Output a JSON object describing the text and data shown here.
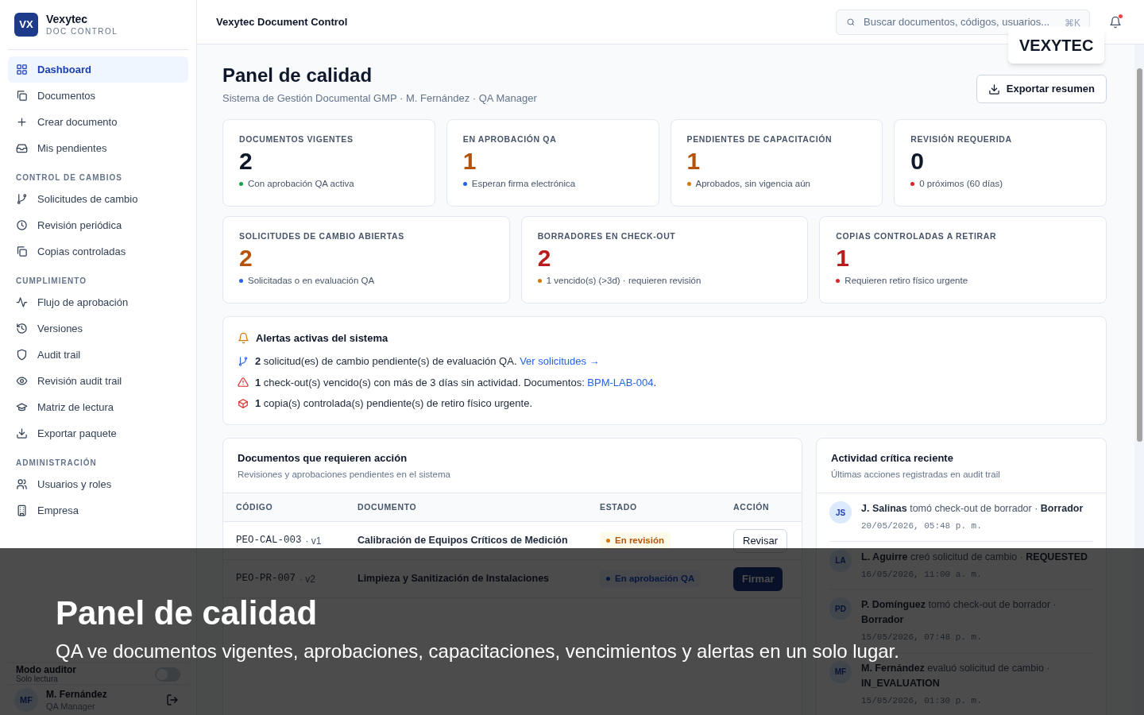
{
  "sidebar": {
    "logo": "VX",
    "brand": "Vexytec",
    "subtitle": "DOC CONTROL",
    "sections": [
      {
        "items": [
          {
            "label": "Dashboard",
            "selected": true
          },
          {
            "label": "Documentos",
            "selected": false
          },
          {
            "label": "Crear documento",
            "selected": false
          },
          {
            "label": "Mis pendientes",
            "selected": false
          }
        ]
      },
      {
        "title": "CONTROL DE CAMBIOS",
        "items": [
          {
            "label": "Solicitudes de cambio",
            "selected": false
          },
          {
            "label": "Revisión periódica",
            "selected": false
          },
          {
            "label": "Copias controladas",
            "selected": false
          }
        ]
      },
      {
        "title": "CUMPLIMIENTO",
        "items": [
          {
            "label": "Flujo de aprobación",
            "selected": false
          },
          {
            "label": "Versiones",
            "selected": false
          },
          {
            "label": "Audit trail",
            "selected": false
          },
          {
            "label": "Revisión audit trail",
            "selected": false
          },
          {
            "label": "Matriz de lectura",
            "selected": false
          },
          {
            "label": "Exportar paquete",
            "selected": false
          }
        ]
      },
      {
        "title": "ADMINISTRACIÓN",
        "items": [
          {
            "label": "Usuarios y roles",
            "selected": false
          },
          {
            "label": "Empresa",
            "selected": false
          }
        ]
      }
    ],
    "auditor_mode": {
      "label": "Modo auditor",
      "note": "Solo lectura",
      "on": false
    },
    "user": {
      "initials": "MF",
      "name": "M. Fernández",
      "role": "QA Manager"
    }
  },
  "header": {
    "title": "Vexytec Document Control",
    "search": {
      "placeholder": "Buscar documentos, códigos, usuarios...",
      "shortcut": "⌘K"
    },
    "unread": true,
    "brand_badge": "VEXYTEC"
  },
  "page": {
    "title": "Panel de calidad",
    "subtitle": "Sistema de Gestión Documental GMP · M. Fernández · QA Manager",
    "export_button": "Exportar resumen"
  },
  "stats": [
    {
      "label": "DOCUMENTOS VIGENTES",
      "value": "2",
      "kind": "neutral",
      "note": "Con aprobación QA activa",
      "color": "#16a34a"
    },
    {
      "label": "EN APROBACIÓN QA",
      "value": "1",
      "kind": "warning",
      "note": "Esperan firma electrónica",
      "color": "#2563eb"
    },
    {
      "label": "PENDIENTES DE CAPACITACIÓN",
      "value": "1",
      "kind": "warning",
      "note": "Aprobados, sin vigencia aún",
      "color": "#d97706"
    },
    {
      "label": "REVISIÓN REQUERIDA",
      "value": "0",
      "kind": "neutral",
      "note": "0 próximos (60 días)",
      "color": "#dc2626"
    }
  ],
  "stats_secondary": [
    {
      "label": "SOLICITUDES DE CAMBIO ABIERTAS",
      "value": "2",
      "kind": "warning",
      "note": "Solicitadas o en evaluación QA",
      "color": "#2563eb"
    },
    {
      "label": "BORRADORES EN CHECK-OUT",
      "value": "2",
      "kind": "danger",
      "note": "1 vencido(s) (>3d) · requieren revisión",
      "color": "#d97706"
    },
    {
      "label": "COPIAS CONTROLADAS A RETIRAR",
      "value": "1",
      "kind": "danger",
      "note": "Requieren retiro físico urgente",
      "color": "#dc2626"
    }
  ],
  "alerts": {
    "title": "Alertas activas del sistema",
    "items": [
      {
        "kind": "request",
        "text": "**2** solicitud(es) de cambio pendiente(s) de evaluación QA. ",
        "link": "Ver solicitudes →"
      },
      {
        "kind": "warning",
        "text": "**1** check-out(s) vencido(s) con más de 3 días sin actividad. Documentos: ",
        "link": "BPM-LAB-004",
        "after": "."
      },
      {
        "kind": "package",
        "text": "**1** copia(s) controlada(s) pendiente(s) de retiro físico urgente."
      }
    ]
  },
  "documents": {
    "title": "Documentos que requieren acción",
    "subtitle": "Revisiones y aprobaciones pendientes en el sistema",
    "columns": [
      "CÓDIGO",
      "DOCUMENTO",
      "ESTADO",
      "ACCIÓN"
    ],
    "rows": [
      {
        "code": "PEO-CAL-003",
        "version": "· v1",
        "title": "Calibración de Equipos Críticos de Medición",
        "status": {
          "kind": "review",
          "label": "En revisión"
        },
        "action": {
          "kind": "outline",
          "label": "Revisar"
        }
      },
      {
        "code": "PEO-PR-007",
        "version": "· v2",
        "title": "Limpieza y Sanitización de Instalaciones",
        "status": {
          "kind": "approval",
          "label": "En aprobación QA"
        },
        "action": {
          "kind": "primary",
          "label": "Firmar"
        }
      }
    ]
  },
  "activity": {
    "title": "Actividad crítica reciente",
    "subtitle": "Últimas acciones registradas en audit trail",
    "items": [
      {
        "initials": "JS",
        "actor": "J. Salinas",
        "action": "tomó check-out de borrador ·",
        "target": "Borrador",
        "time": "20/05/2026, 05:48 p. m."
      },
      {
        "initials": "LA",
        "actor": "L. Aguirre",
        "action": "creó solicitud de cambio ·",
        "target": "REQUESTED",
        "time": "16/05/2026, 11:00 a. m."
      },
      {
        "initials": "PD",
        "actor": "P. Domínguez",
        "action": "tomó check-out de borrador ·",
        "target": "Borrador",
        "time": "15/05/2026, 07:48 p. m."
      },
      {
        "initials": "MF",
        "actor": "M. Fernández",
        "action": "evaluó solicitud de cambio ·",
        "target": "IN_EVALUATION",
        "time": "15/05/2026, 01:30 p. m."
      }
    ]
  },
  "caption": {
    "title": "Panel de calidad",
    "text": "QA ve documentos vigentes, aprobaciones, capacitaciones, vencimientos y alertas en un solo lugar."
  }
}
